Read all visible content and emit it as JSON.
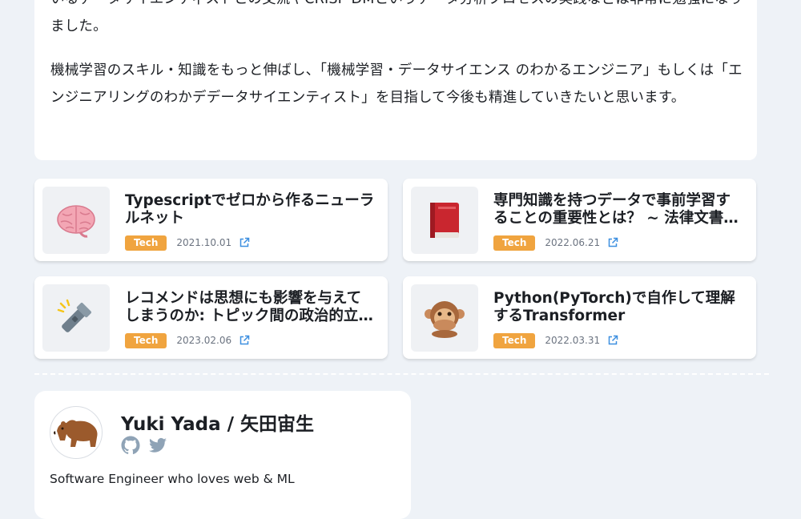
{
  "article": {
    "paragraph1": "いるデータサイエンティストとの交流やCRISP-DMというデータ分析プロセスの実践などは非常に勉強になりました。",
    "paragraph2": "機械学習のスキル・知識をもっと伸ばし、「機械学習・データサイエンス のわかるエンジニア」もしくは「エンジニアリングのわかデデータサイエンティスト」を目指して今後も精進していきたいと思います。"
  },
  "related_posts": [
    {
      "title": "Typescriptでゼロから作るニューラルネット",
      "tag": "Tech",
      "date": "2021.10.01",
      "icon": "brain-icon"
    },
    {
      "title": "専門知識を持つデータで事前学習することの重要性とは？ ~ 法律文書…",
      "tag": "Tech",
      "date": "2022.06.21",
      "icon": "red-book-icon"
    },
    {
      "title": "レコメンドは思想にも影響を与えてしまうのか: トピック間の政治的立…",
      "tag": "Tech",
      "date": "2023.02.06",
      "icon": "flashlight-icon"
    },
    {
      "title": "Python(PyTorch)で自作して理解するTransformer",
      "tag": "Tech",
      "date": "2022.03.31",
      "icon": "speak-no-evil-monkey-icon"
    }
  ],
  "profile": {
    "name": "Yuki Yada / 矢田宙生",
    "bio": "Software Engineer who loves web & ML",
    "social": [
      "github-icon",
      "twitter-icon"
    ]
  },
  "colors": {
    "background": "#eef2f7",
    "tag": "#f0a43f",
    "link_icon": "#3d8fe0",
    "social_icon": "#8fa3b6"
  }
}
